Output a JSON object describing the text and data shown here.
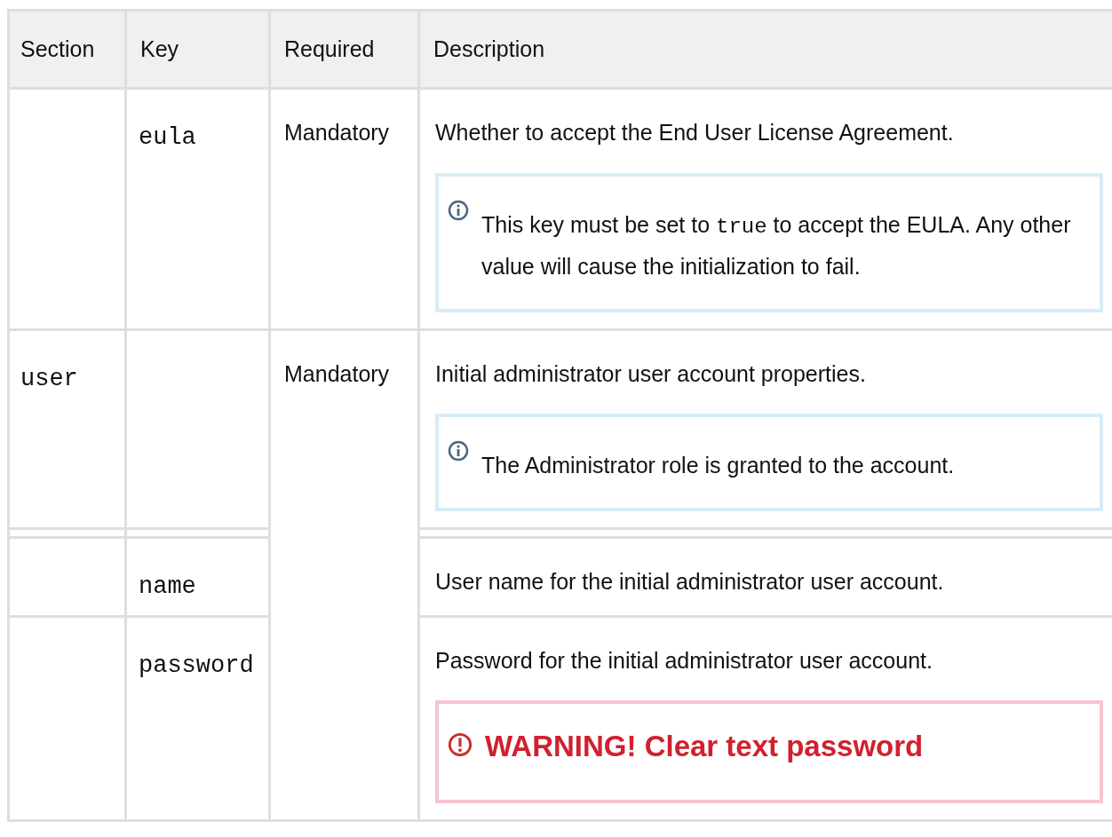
{
  "columns": [
    "Section",
    "Key",
    "Required",
    "Description"
  ],
  "rows": [
    {
      "key": "eula",
      "required": "Mandatory",
      "description": "Whether to accept the End User License Agreement.",
      "note": {
        "kind": "info",
        "segments": [
          {
            "text": "This key must be set to "
          },
          {
            "kind": "code",
            "text": "true"
          },
          {
            "text": " to accept the EULA. Any other value will cause the initialization to fail."
          }
        ]
      }
    },
    {
      "section": "user",
      "required": "Mandatory",
      "description": "Initial administrator user account properties.",
      "note": {
        "kind": "info",
        "segments": [
          {
            "text": "The Administrator role is granted to the account."
          }
        ]
      },
      "children": [
        {
          "key": "name",
          "description": "User name for the initial administrator user account."
        },
        {
          "key": "password",
          "description": "Password for the initial administrator user account.",
          "note": {
            "kind": "warning",
            "segments": [
              {
                "text": "WARNING! Clear text password"
              }
            ]
          }
        }
      ]
    }
  ]
}
